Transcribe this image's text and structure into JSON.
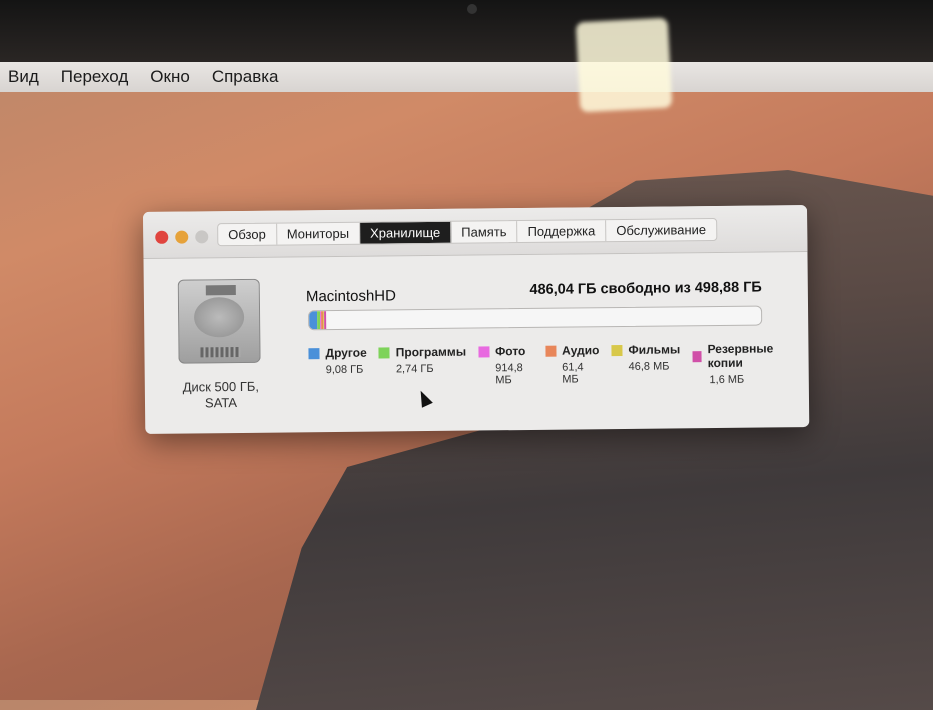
{
  "menubar": {
    "items": [
      "Вид",
      "Переход",
      "Окно",
      "Справка"
    ]
  },
  "window": {
    "tabs": [
      "Обзор",
      "Мониторы",
      "Хранилище",
      "Память",
      "Поддержка",
      "Обслуживание"
    ],
    "active_tab": 2,
    "disk_caption_line1": "Диск 500 ГБ,",
    "disk_caption_line2": "SATA",
    "volume_name": "MacintoshHD",
    "free_text": "486,04 ГБ свободно из 498,88 ГБ",
    "total_gb": 498.88,
    "categories": [
      {
        "label": "Другое",
        "size": "9,08 ГБ",
        "gb": 9.08,
        "color": "#4a90d9"
      },
      {
        "label": "Программы",
        "size": "2,74 ГБ",
        "gb": 2.74,
        "color": "#7ed35a"
      },
      {
        "label": "Фото",
        "size": "914,8 МБ",
        "gb": 0.9148,
        "color": "#e86ae0"
      },
      {
        "label": "Аудио",
        "size": "61,4 МБ",
        "gb": 0.0614,
        "color": "#e8865a"
      },
      {
        "label": "Фильмы",
        "size": "46,8 МБ",
        "gb": 0.0468,
        "color": "#d8c84a"
      },
      {
        "label": "Резервные копии",
        "size": "1,6 МБ",
        "gb": 0.0016,
        "color": "#d050a8"
      }
    ]
  }
}
